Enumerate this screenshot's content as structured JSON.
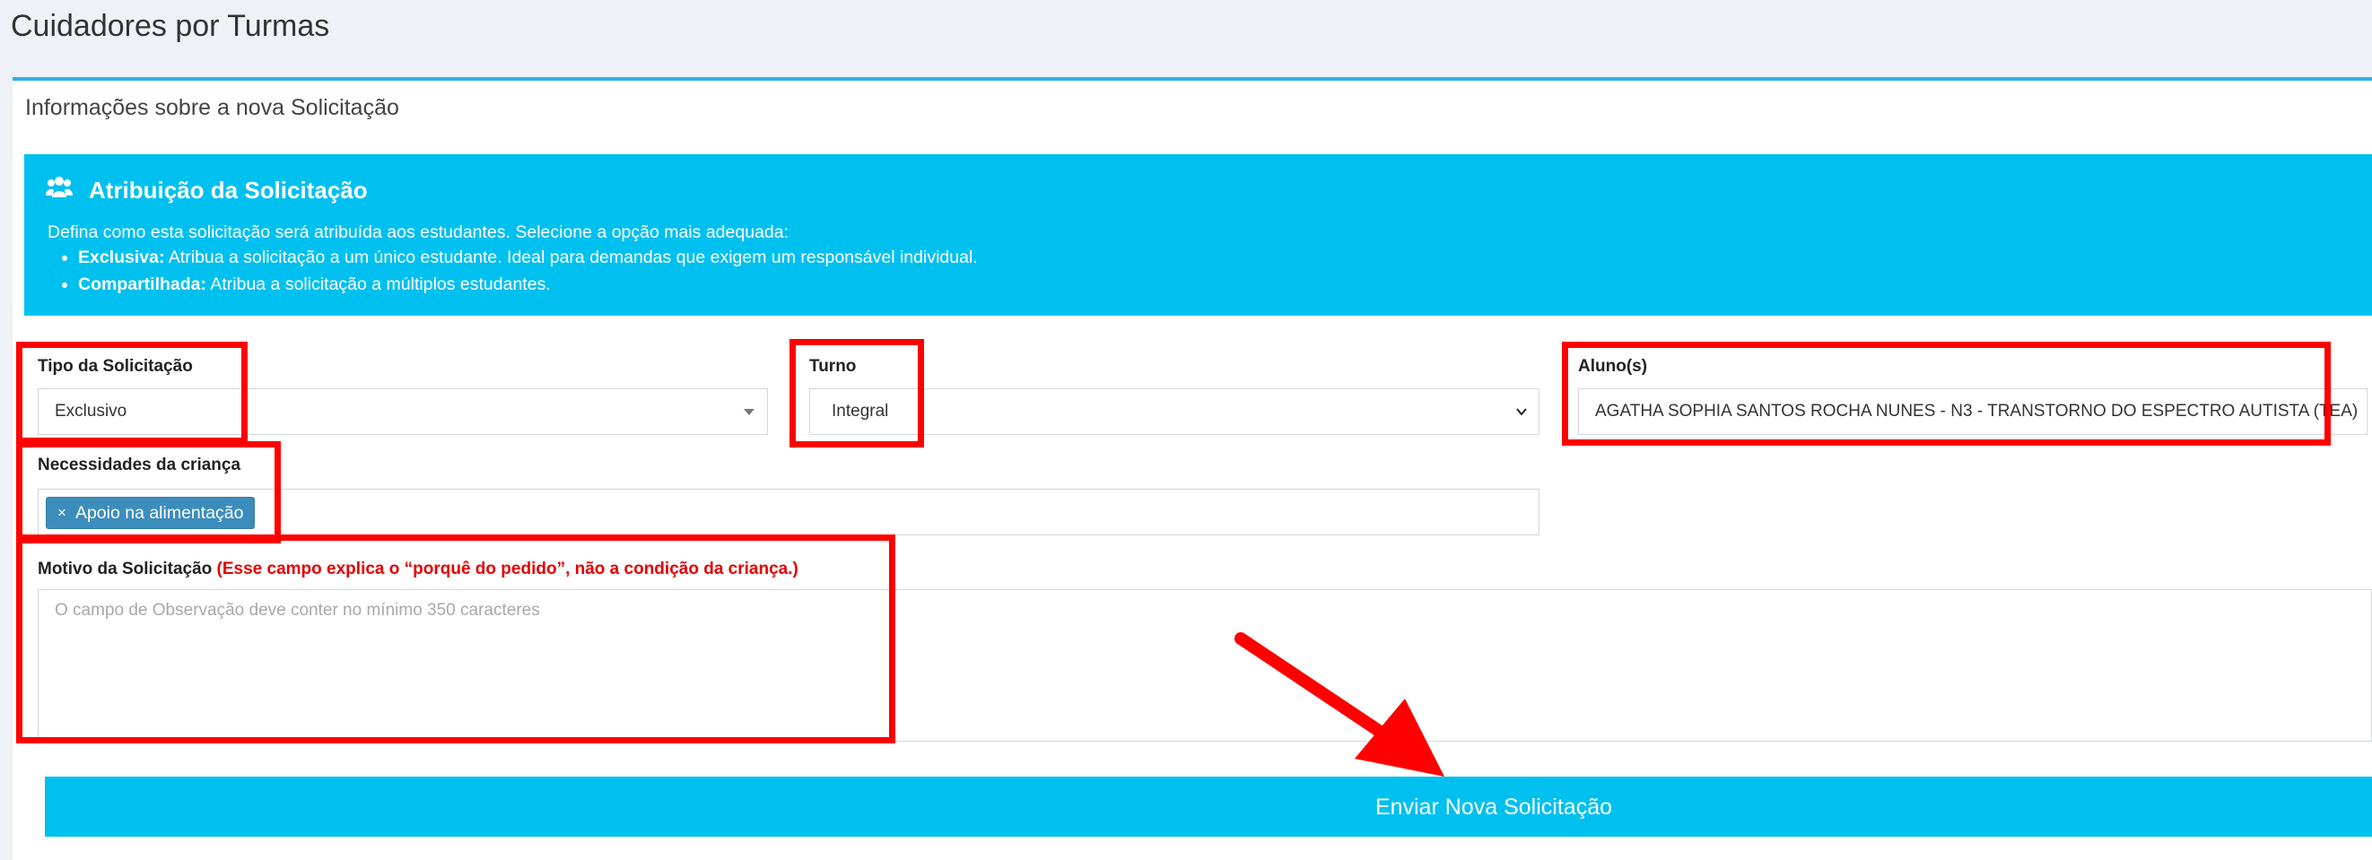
{
  "page": {
    "title": "Cuidadores por Turmas"
  },
  "card": {
    "header": "Informações sobre a nova Solicitação"
  },
  "info": {
    "title": "Atribuição da Solicitação",
    "description": "Defina como esta solicitação será atribuída aos estudantes. Selecione a opção mais adequada:",
    "items": [
      {
        "term": "Exclusiva:",
        "text": " Atribua a solicitação a um único estudante. Ideal para demandas que exigem um responsável individual."
      },
      {
        "term": "Compartilhada:",
        "text": " Atribua a solicitação a múltiplos estudantes."
      }
    ]
  },
  "form": {
    "tipo": {
      "label": "Tipo da Solicitação",
      "value": "Exclusivo"
    },
    "turno": {
      "label": "Turno",
      "value": "Integral"
    },
    "aluno": {
      "label": "Aluno(s)",
      "value": "AGATHA SOPHIA SANTOS ROCHA NUNES - N3 - TRANSTORNO DO ESPECTRO AUTISTA (TEA)"
    },
    "necessidades": {
      "label": "Necessidades da criança",
      "tags": [
        {
          "remove": "×",
          "label": "Apoio na alimentação"
        }
      ]
    },
    "motivo": {
      "label": "Motivo da Solicitação",
      "warning": "(Esse campo explica o “porquê do pedido”, não a condição da criança.)",
      "placeholder": "O campo de Observação deve conter no mínimo 350 caracteres",
      "value": ""
    },
    "submit_label": "Enviar Nova Solicitação"
  },
  "annotations": {
    "highlight_color": "#ff0000"
  }
}
